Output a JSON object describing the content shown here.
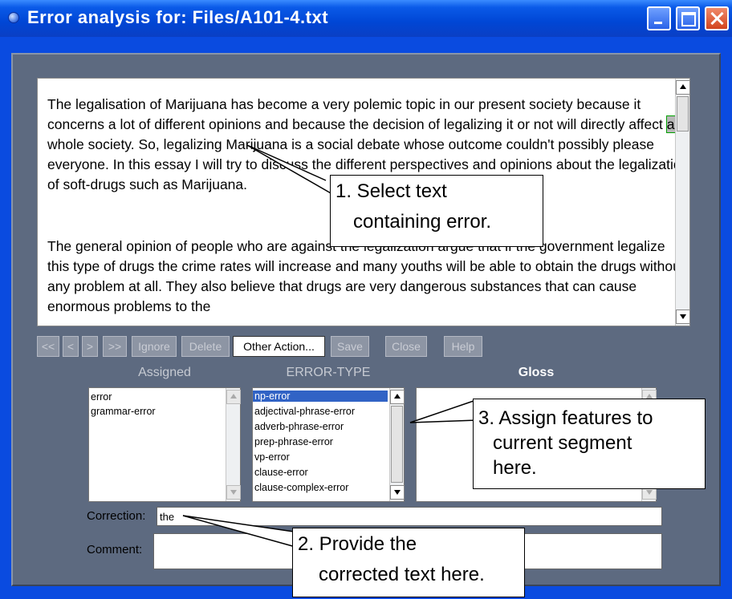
{
  "window": {
    "title": "Error analysis for: Files/A101-4.txt"
  },
  "text_pane": {
    "para1_part1": "The legalisation of Marijuana has become a very polemic topic in our present society because it concerns a lot of different opinions and because the decision of legalizing it or not will directly affect ",
    "para1_highlight": "a",
    "para1_part2": " whole society. So, legalizing Marijuana is a social debate whose outcome couldn't possibly please everyone. In this essay I will try to discuss the different perspectives and opinions about the legalization of soft-drugs such as Marijuana.",
    "para2": "The general opinion of people who are against the legalization argue that if the government legalize this type of drugs the crime rates will increase and many youths will be able to obtain the drugs without any problem at all. They also believe that drugs are very dangerous substances that can cause enormous problems to the"
  },
  "toolbar": {
    "first": "<<",
    "prev": "<",
    "next": ">",
    "last": ">>",
    "ignore": "Ignore",
    "delete": "Delete",
    "other_action": "Other Action...",
    "save": "Save",
    "close": "Close",
    "help": "Help"
  },
  "columns": {
    "assigned": "Assigned",
    "error_type": "ERROR-TYPE",
    "gloss": "Gloss"
  },
  "assigned_list": [
    "error",
    "grammar-error"
  ],
  "error_type_list": [
    "np-error",
    "adjectival-phrase-error",
    "adverb-phrase-error",
    "prep-phrase-error",
    "vp-error",
    "clause-error",
    "clause-complex-error"
  ],
  "error_type_selected": "np-error",
  "correction": {
    "label": "Correction:",
    "value": "the"
  },
  "comment": {
    "label": "Comment:",
    "value": ""
  },
  "callouts": {
    "c1_line1": "1. Select text",
    "c1_line2": "containing error.",
    "c2_line1": "2. Provide the",
    "c2_line2": "corrected text here.",
    "c3_line1": "3. Assign features to",
    "c3_line2": "current segment",
    "c3_line3": "here."
  },
  "colors": {
    "titlebar": "#0a4be0",
    "panel": "#5d6a80",
    "selection": "#3163c5",
    "highlight_outline": "#00a000"
  }
}
